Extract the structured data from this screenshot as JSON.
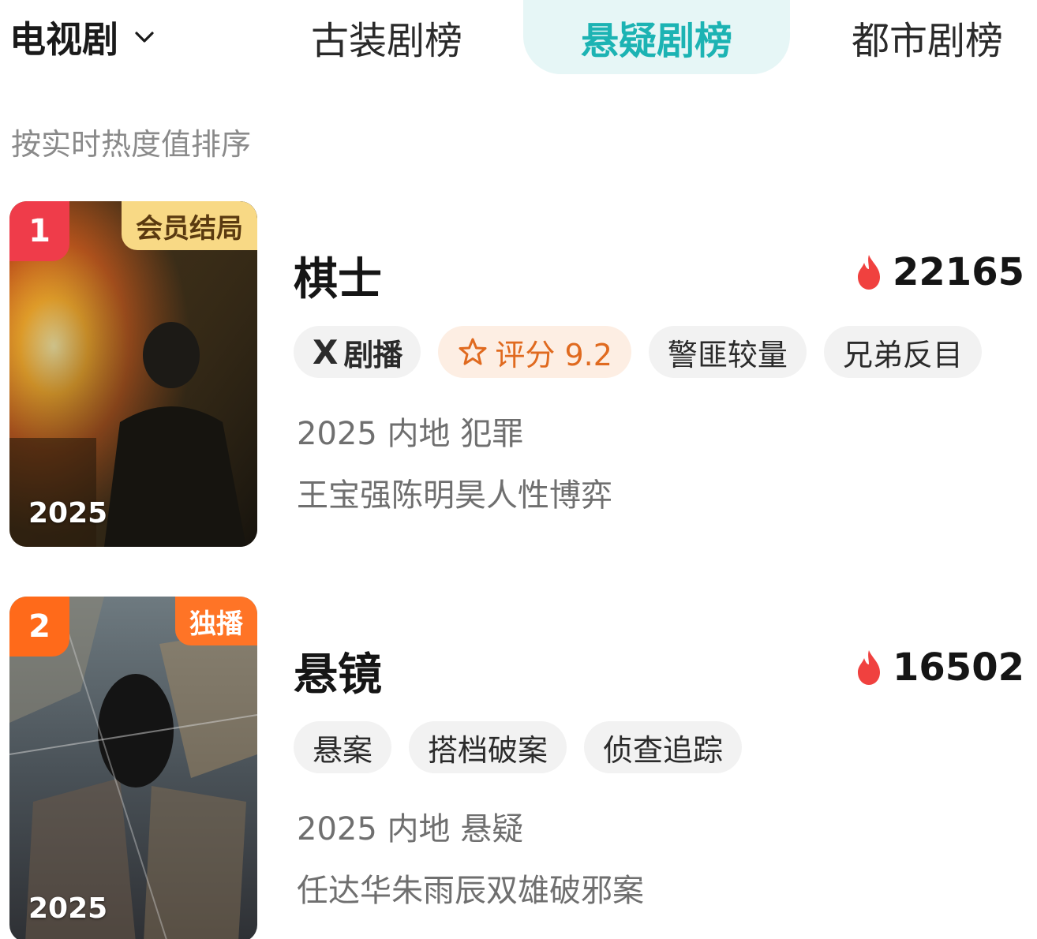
{
  "header": {
    "category_label": "电视剧",
    "tabs": [
      {
        "label": "古装剧榜",
        "active": false
      },
      {
        "label": "悬疑剧榜",
        "active": true
      },
      {
        "label": "都市剧榜",
        "active": false
      }
    ]
  },
  "sort_hint": "按实时热度值排序",
  "items": [
    {
      "rank": "1",
      "corner_tag": "会员结局",
      "poster_year": "2025",
      "title": "棋士",
      "heat": "22165",
      "tags": {
        "brand_x": "X",
        "brand_text": "剧播",
        "rating": "评分 9.2",
        "t1": "警匪较量",
        "t2": "兄弟反目"
      },
      "meta": "2025 内地 犯罪",
      "desc": "王宝强陈明昊人性博弈"
    },
    {
      "rank": "2",
      "corner_tag": "独播",
      "poster_year": "2025",
      "title": "悬镜",
      "heat": "16502",
      "tags": {
        "t1": "悬案",
        "t2": "搭档破案",
        "t3": "侦查追踪"
      },
      "meta": "2025 内地 悬疑",
      "desc": "任达华朱雨辰双雄破邪案"
    }
  ],
  "colors": {
    "active_tab_text": "#1cb3b3",
    "active_tab_bg": "#e6f6f6",
    "rank1": "#ef3c4a",
    "rank2": "#ff6a1a",
    "vip_tag_bg": "#f8d985",
    "exclusive_tag_bg": "#ff7426",
    "heat_flame": "#f0413f",
    "rating_text": "#e06a1f"
  },
  "icons": {
    "category_dropdown": "chevron-down-icon",
    "heat": "flame-icon",
    "rating": "star-outline-icon"
  }
}
